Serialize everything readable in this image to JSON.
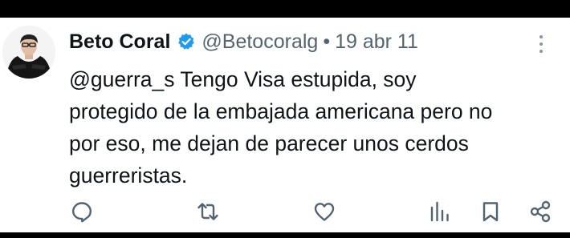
{
  "tweet": {
    "author": {
      "name": "Beto Coral",
      "handle": "@Betocoralg",
      "verified": true
    },
    "separator": "•",
    "time": "19 abr 11",
    "text_lines": [
      "@guerra_s Tengo Visa estupida, soy",
      "protegido de la embajada americana pero no",
      "por eso, me dejan de parecer unos cerdos",
      "guerreristas."
    ]
  },
  "colors": {
    "text": "#0f1419",
    "secondary": "#536471",
    "verified_badge": "#1d9bf0",
    "icon": "#536471"
  },
  "icons": {
    "more": "more-options-icon",
    "reply": "reply-icon",
    "retweet": "retweet-icon",
    "like": "like-icon",
    "views": "views-icon",
    "bookmark": "bookmark-icon",
    "share": "share-icon"
  }
}
